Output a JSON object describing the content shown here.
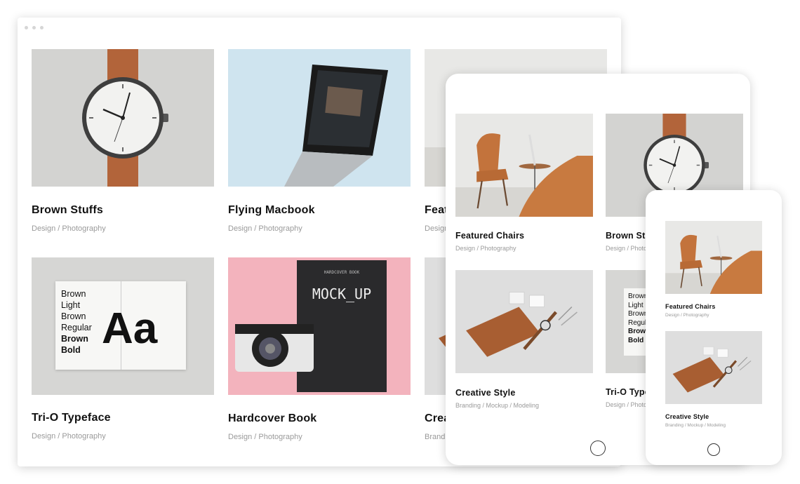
{
  "desktop": {
    "cards": [
      {
        "title": "Brown Stuffs",
        "cats": "Design / Photography"
      },
      {
        "title": "Flying Macbook",
        "cats": "Design / Photography"
      },
      {
        "title": "Featured Chairs",
        "cats": "Design / Photography"
      },
      {
        "title": "Tri-O Typeface",
        "cats": "Design / Photography"
      },
      {
        "title": "Hardcover Book",
        "cats": "Design / Photography"
      },
      {
        "title": "Creative Style",
        "cats": "Branding / Mockup / Modeling"
      }
    ]
  },
  "tablet": {
    "cards": [
      {
        "title": "Featured Chairs",
        "cats": "Design / Photography"
      },
      {
        "title": "Brown Stuffs",
        "cats": "Design / Photography"
      },
      {
        "title": "Creative Style",
        "cats": "Branding / Mockup / Modeling"
      },
      {
        "title": "Tri-O Typeface",
        "cats": "Design / Photography"
      }
    ]
  },
  "phone": {
    "cards": [
      {
        "title": "Featured Chairs",
        "cats": "Design / Photography"
      },
      {
        "title": "Creative Style",
        "cats": "Branding / Mockup / Modeling"
      }
    ]
  },
  "artwork": {
    "typeface_lines": [
      "Brown",
      "Light",
      "Brown",
      "Regular",
      "Brown",
      "Bold"
    ],
    "typeface_glyph": "Aa",
    "book_label": "HARDCOVER BOOK",
    "book_title": "MOCK_UP"
  }
}
